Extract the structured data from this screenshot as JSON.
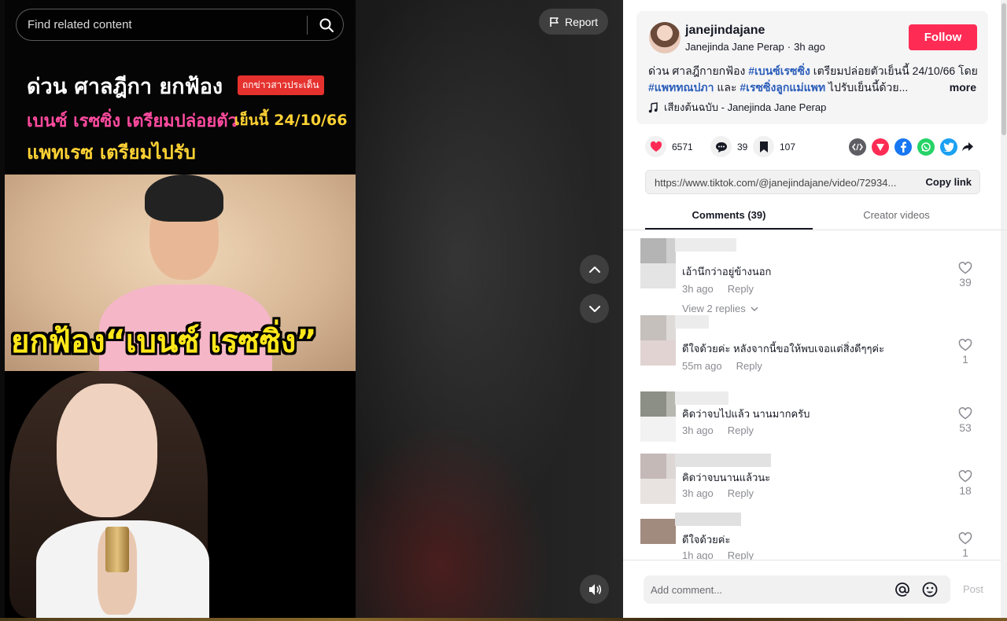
{
  "search": {
    "placeholder": "Find related content"
  },
  "report_label": "Report",
  "video": {
    "headline_line1": "ด่วน ศาลฎีกา ยกฟ้อง",
    "headline_badge": "ถกข่าวสาวประเด็น",
    "headline_line2_pink": "เบนซ์ เรซซิ่ง เตรียมปล่อยตัว",
    "headline_line2_yellow": "เย็นนี้ 24/10/66",
    "headline_line3": "แพทเรซ เตรียมไปรับ",
    "image_caption": "ยกฟ้อง“เบนซ์ เรซซิ่ง”"
  },
  "author": {
    "username": "janejindajane",
    "display_name": "Janejinda Jane Perap",
    "time": "3h ago",
    "follow_label": "Follow"
  },
  "caption": {
    "part1": "ด่วน ศาลฎีกายกฟ้อง ",
    "tag1": "#เบนซ์เรซซิ่ง",
    "part2": " เตรียมปล่อยตัวเย็นนี้ 24/10/66 โดย ",
    "tag2": "#แพททณปภา",
    "part3": " และ ",
    "tag3": "#เรซซิ่งลูกแม่แพท",
    "part4": " ไปรับเย็นนี้ด้วย...",
    "more_label": "more",
    "music": "เสียงต้นฉบับ - Janejinda Jane Perap"
  },
  "actions": {
    "likes": "6571",
    "comments": "39",
    "saves": "107"
  },
  "share_icons": [
    "embed-icon",
    "friends-icon",
    "facebook-icon",
    "whatsapp-icon",
    "twitter-icon",
    "share-arrow-icon"
  ],
  "link": {
    "url": "https://www.tiktok.com/@janejindajane/video/72934...",
    "copy_label": "Copy link"
  },
  "tabs": {
    "comments": "Comments (39)",
    "creator": "Creator videos"
  },
  "comments": [
    {
      "text": "เอ้านึกว่าอยู่ข้างนอก",
      "time": "3h ago",
      "reply": "Reply",
      "likes": "39",
      "view_replies": "View 2 replies"
    },
    {
      "text": "ดีใจด้วยค่ะ หลังจากนี้ขอให้พบเจอแต่สิ่งดีๆๆค่ะ",
      "time": "55m ago",
      "reply": "Reply",
      "likes": "1"
    },
    {
      "text": "คิดว่าจบไปแล้ว นานมากครับ",
      "time": "3h ago",
      "reply": "Reply",
      "likes": "53"
    },
    {
      "text": "คิดว่าจบนานแล้วนะ",
      "time": "3h ago",
      "reply": "Reply",
      "likes": "18"
    },
    {
      "text": "ดีใจด้วยค่ะ",
      "time": "1h ago",
      "reply": "Reply",
      "likes": "1"
    }
  ],
  "composer": {
    "placeholder": "Add comment...",
    "post_label": "Post"
  },
  "colors": {
    "accent": "#fe2c55",
    "hashtag": "#2b5db9",
    "like_heart": "#fe2c55",
    "facebook": "#1877f2",
    "whatsapp": "#25d366",
    "twitter": "#1da1f2",
    "friends": "#fe2c55"
  }
}
